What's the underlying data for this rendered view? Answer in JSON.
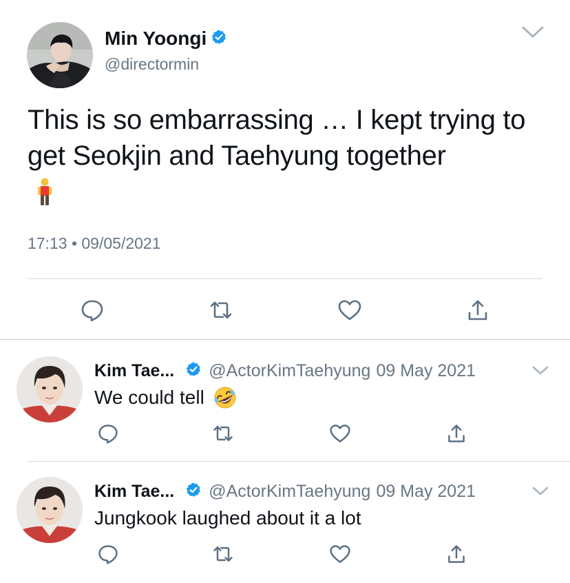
{
  "main_tweet": {
    "author_name": "Min Yoongi",
    "handle": "@directormin",
    "text": "This is so embarrassing … I kept trying to get Seokjin and Taehyung together",
    "emoji": "person-standing-emoji",
    "timestamp": "17:13 • 09/05/2021"
  },
  "replies": [
    {
      "author_name": "Kim Tae...",
      "handle": "@ActorKimTaehyung",
      "date": "09 May 2021",
      "text": "We could tell",
      "emoji": "rolling-laughing-emoji"
    },
    {
      "author_name": "Kim Tae...",
      "handle": "@ActorKimTaehyung",
      "date": "09 May 2021",
      "text": "Jungkook laughed about it a lot"
    }
  ],
  "colors": {
    "verified_blue": "#1d9bf0",
    "secondary_text": "#687684",
    "icon_gray": "#5b7083",
    "divider": "#d2d8dc"
  },
  "icons": {
    "reply": "reply-icon",
    "retweet": "retweet-icon",
    "like": "heart-icon",
    "share": "share-icon",
    "menu": "chevron-down-icon",
    "verified": "verified-badge-icon"
  }
}
